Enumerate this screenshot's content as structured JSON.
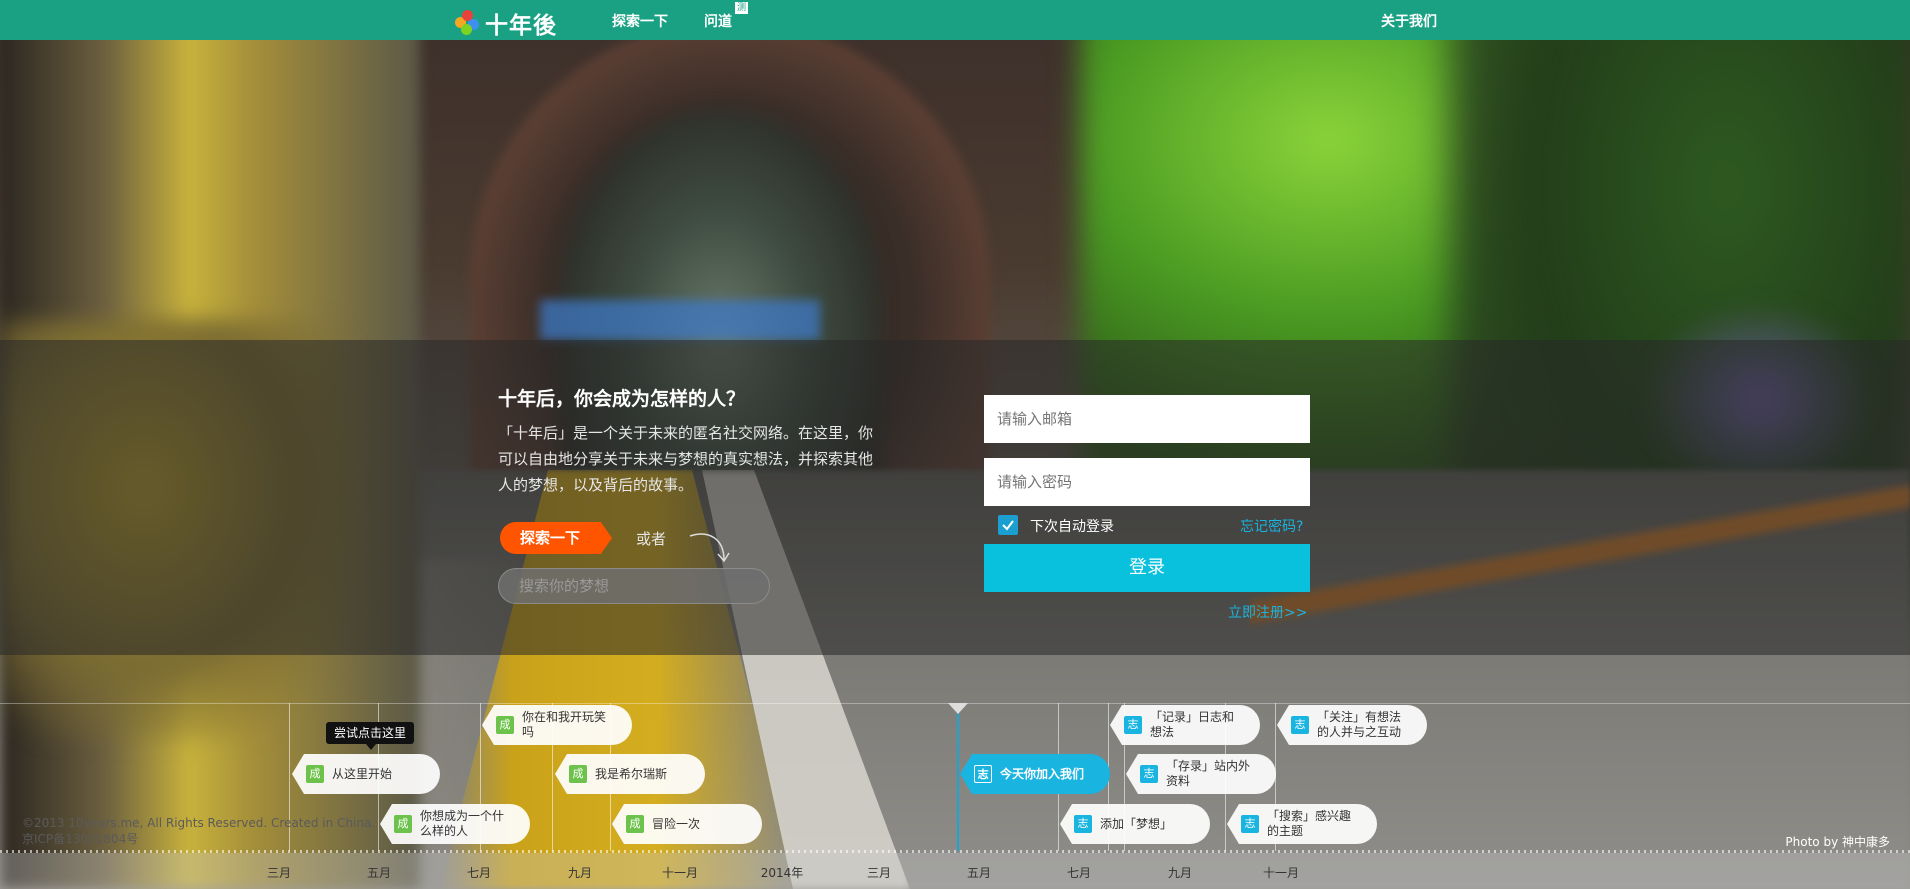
{
  "nav": {
    "logo_text": "十年後",
    "explore_label": "探索一下",
    "wendao_label": "问道",
    "wendao_badge": "测",
    "about_label": "关于我们"
  },
  "intro": {
    "title": "十年后，你会成为怎样的人？",
    "description": "「十年后」是一个关于未来的匿名社交网络。在这里，你可以自由地分享关于未来与梦想的真实想法，并探索其他人的梦想，以及背后的故事。",
    "explore_button": "探索一下",
    "or_text": "或者",
    "search_placeholder": "搜索你的梦想"
  },
  "login": {
    "email_placeholder": "请输入邮箱",
    "password_placeholder": "请输入密码",
    "remember_label": "下次自动登录",
    "remember_checked": true,
    "forgot_label": "忘记密码?",
    "login_button": "登录",
    "register_label": "立即注册>>"
  },
  "timeline": {
    "tooltip": "尝试点击这里",
    "months": [
      "三月",
      "五月",
      "七月",
      "九月",
      "十一月",
      "2014年",
      "三月",
      "五月",
      "七月",
      "九月",
      "十一月"
    ],
    "events": [
      {
        "tag": "成",
        "text": "从这里开始",
        "color": "green"
      },
      {
        "tag": "成",
        "text": "你想成为一个什么样的人",
        "color": "green"
      },
      {
        "tag": "成",
        "text": "你在和我开玩笑吗",
        "color": "green"
      },
      {
        "tag": "成",
        "text": "我是希尔瑞斯",
        "color": "green"
      },
      {
        "tag": "成",
        "text": "冒险一次",
        "color": "green"
      },
      {
        "tag": "志",
        "text": "今天你加入我们",
        "color": "blue"
      },
      {
        "tag": "志",
        "text": "添加「梦想」",
        "color": "blue"
      },
      {
        "tag": "志",
        "text": "「记录」日志和想法",
        "color": "blue"
      },
      {
        "tag": "志",
        "text": "「存录」站内外资料",
        "color": "blue"
      },
      {
        "tag": "志",
        "text": "「搜索」感兴趣的主题",
        "color": "blue"
      },
      {
        "tag": "志",
        "text": "「关注」有想法的人并与之互动",
        "color": "blue"
      }
    ]
  },
  "footer": {
    "copyright": "©2013 10years.me, All Rights Reserved. Created in China.",
    "icp": "京ICP备13021804号",
    "photo_credit": "Photo by 神中康多"
  },
  "colors": {
    "nav_bg": "#1aa184",
    "explore_orange": "#ff5500",
    "login_button": "#09c0dd",
    "link_blue": "#19b4e0",
    "tag_green": "#6cc24a"
  }
}
